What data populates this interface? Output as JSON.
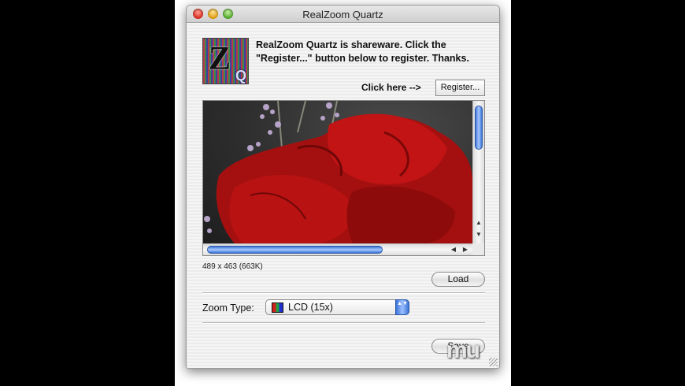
{
  "window": {
    "title": "RealZoom Quartz"
  },
  "logo": {
    "letter": "Z",
    "badge": "Q"
  },
  "header": {
    "message": "RealZoom Quartz is shareware. Click the \"Register...\" button below to register. Thanks.",
    "click_here": "Click here -->",
    "register_label": "Register..."
  },
  "image_info": {
    "dimensions": "489 x 463 (663K)"
  },
  "buttons": {
    "load_label": "Load",
    "save_label": "Save"
  },
  "zoom": {
    "label": "Zoom Type:",
    "value": "LCD (15x)"
  },
  "scroll_arrows": {
    "up": "▲",
    "down": "▼",
    "left": "◀",
    "right": "▶"
  },
  "stepper_glyph": "▲▼",
  "watermark": "mu",
  "icons": [
    "close-icon",
    "minimize-icon",
    "zoom-icon",
    "lcd-icon",
    "resize-grip-icon"
  ]
}
